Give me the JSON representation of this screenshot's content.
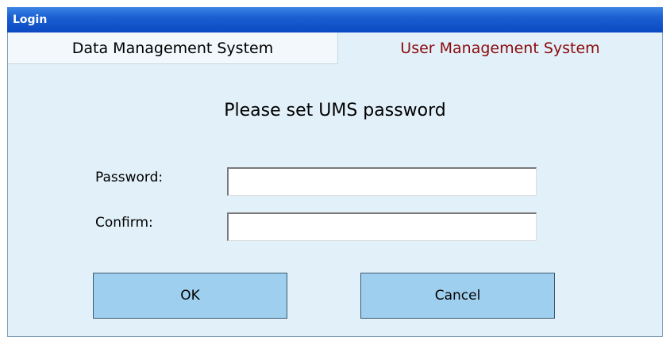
{
  "window": {
    "title": "Login"
  },
  "tabs": [
    {
      "label": "Data Management System"
    },
    {
      "label": "User Management System"
    }
  ],
  "main": {
    "heading": "Please set UMS password",
    "password_label": "Password:",
    "password_value": "",
    "confirm_label": "Confirm:",
    "confirm_value": "",
    "ok_label": "OK",
    "cancel_label": "Cancel"
  },
  "colors": {
    "titlebar": "#1b5fd1",
    "window_background": "#e2f0f9",
    "active_tab_text": "#8b0a0a",
    "button_background": "#9fcfee"
  }
}
